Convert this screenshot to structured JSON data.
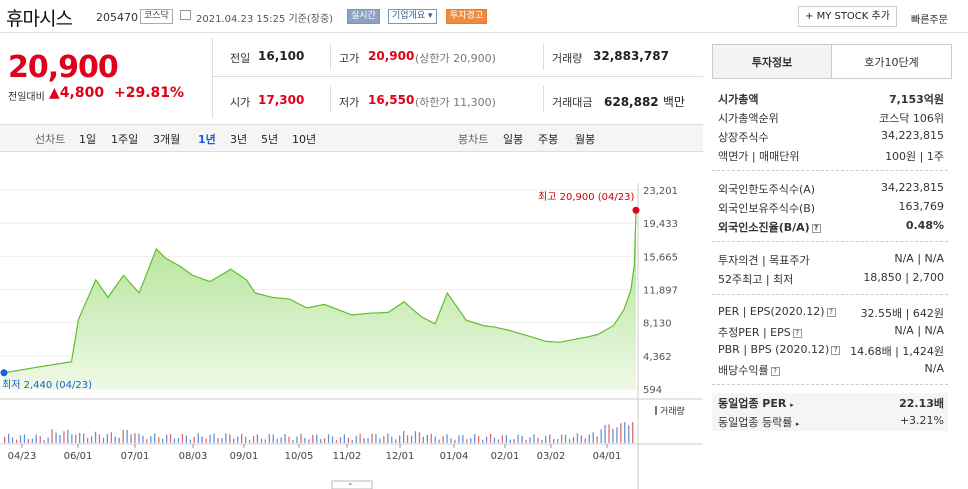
{
  "header": {
    "name": "휴마시스",
    "code": "205470",
    "market": "코스닥",
    "datetime": "2021.04.23 15:25",
    "basis": "기준(장중)",
    "realtime": "실시간",
    "company_overview": "기업개요",
    "warning": "투자경고",
    "my_stock": "MY STOCK 추가",
    "quick_order": "빠른주문"
  },
  "quote": {
    "price": "20,900",
    "change_label": "전일대비",
    "change": "4,800",
    "change_pct": "+29.81%",
    "prev_close_label": "전일",
    "prev_close": "16,100",
    "high_label": "고가",
    "high": "20,900",
    "high_limit": "(상한가 20,900)",
    "volume_label": "거래량",
    "volume": "32,883,787",
    "open_label": "시가",
    "open": "17,300",
    "low_label": "저가",
    "low": "16,550",
    "low_limit": "(하한가 11,300)",
    "amount_label": "거래대금",
    "amount": "628,882",
    "amount_unit": "백만"
  },
  "chart_tabs": {
    "line_label": "선차트",
    "line_items": [
      "1일",
      "1주일",
      "3개월",
      "1년",
      "3년",
      "5년",
      "10년"
    ],
    "active": "1년",
    "candle_label": "봉차트",
    "candle_items": [
      "일봉",
      "주봉",
      "월봉"
    ]
  },
  "chart_data": {
    "type": "area",
    "y_ticks": [
      "23,201",
      "19,433",
      "15,665",
      "11,897",
      "8,130",
      "4,362",
      "594"
    ],
    "ylim": [
      594,
      23201
    ],
    "x_ticks": [
      "04/23",
      "06/01",
      "07/01",
      "08/03",
      "09/01",
      "10/05",
      "11/02",
      "12/01",
      "01/04",
      "02/01",
      "03/02",
      "04/01"
    ],
    "high_label": "최고 20,900 (04/23)",
    "low_label": "최저 2,440 (04/23)",
    "volume_label": "거래량",
    "x": [
      "04/23",
      "05/10",
      "05/26",
      "06/01",
      "06/05",
      "06/15",
      "06/22",
      "07/01",
      "07/10",
      "07/20",
      "07/25",
      "08/03",
      "08/10",
      "08/20",
      "09/01",
      "09/10",
      "09/15",
      "09/25",
      "10/05",
      "10/15",
      "10/25",
      "11/02",
      "11/10",
      "11/20",
      "12/01",
      "12/10",
      "12/20",
      "12/28",
      "01/04",
      "01/15",
      "01/25",
      "02/01",
      "02/10",
      "02/20",
      "03/02",
      "03/10",
      "03/20",
      "03/26",
      "04/01",
      "04/10",
      "04/16",
      "04/20",
      "04/22",
      "04/23"
    ],
    "values": [
      2440,
      3000,
      3500,
      3700,
      8500,
      13000,
      11000,
      13500,
      11500,
      16500,
      15500,
      14500,
      13500,
      12800,
      14200,
      13000,
      11500,
      11000,
      10800,
      9800,
      10200,
      9600,
      9000,
      9200,
      9300,
      10500,
      8800,
      8000,
      11500,
      8400,
      7800,
      7600,
      7200,
      6600,
      6000,
      5900,
      6300,
      6500,
      6800,
      7800,
      9600,
      11800,
      14700,
      20900
    ]
  },
  "invest": {
    "tab1": "투자정보",
    "tab2": "호가10단계",
    "market_cap_label": "시가총액",
    "market_cap": "7,153억원",
    "rank_label": "시가총액순위",
    "rank": "코스닥 106위",
    "shares_label": "상장주식수",
    "shares": "34,223,815",
    "par_label": "액면가 | 매매단위",
    "par": "100원 | 1주",
    "foreign_limit_label": "외국인한도주식수(A)",
    "foreign_limit": "34,223,815",
    "foreign_hold_label": "외국인보유주식수(B)",
    "foreign_hold": "163,769",
    "foreign_rate_label": "외국인소진율(B/A)",
    "foreign_rate": "0.48%",
    "opinion_label": "투자의견 | 목표주가",
    "opinion": "N/A | N/A",
    "week52_label": "52주최고 | 최저",
    "week52": "18,850 | 2,700",
    "per_label": "PER | EPS(2020.12)",
    "per": "32.55배 | 642원",
    "est_per_label": "추정PER | EPS",
    "est_per": "N/A | N/A",
    "pbr_label": "PBR | BPS (2020.12)",
    "pbr": "14.68배 | 1,424원",
    "div_label": "배당수익률",
    "div": "N/A",
    "sector_per_label": "동일업종 PER",
    "sector_per": "22.13배",
    "sector_rate_label": "동일업종 등락률",
    "sector_rate": "+3.21%"
  }
}
